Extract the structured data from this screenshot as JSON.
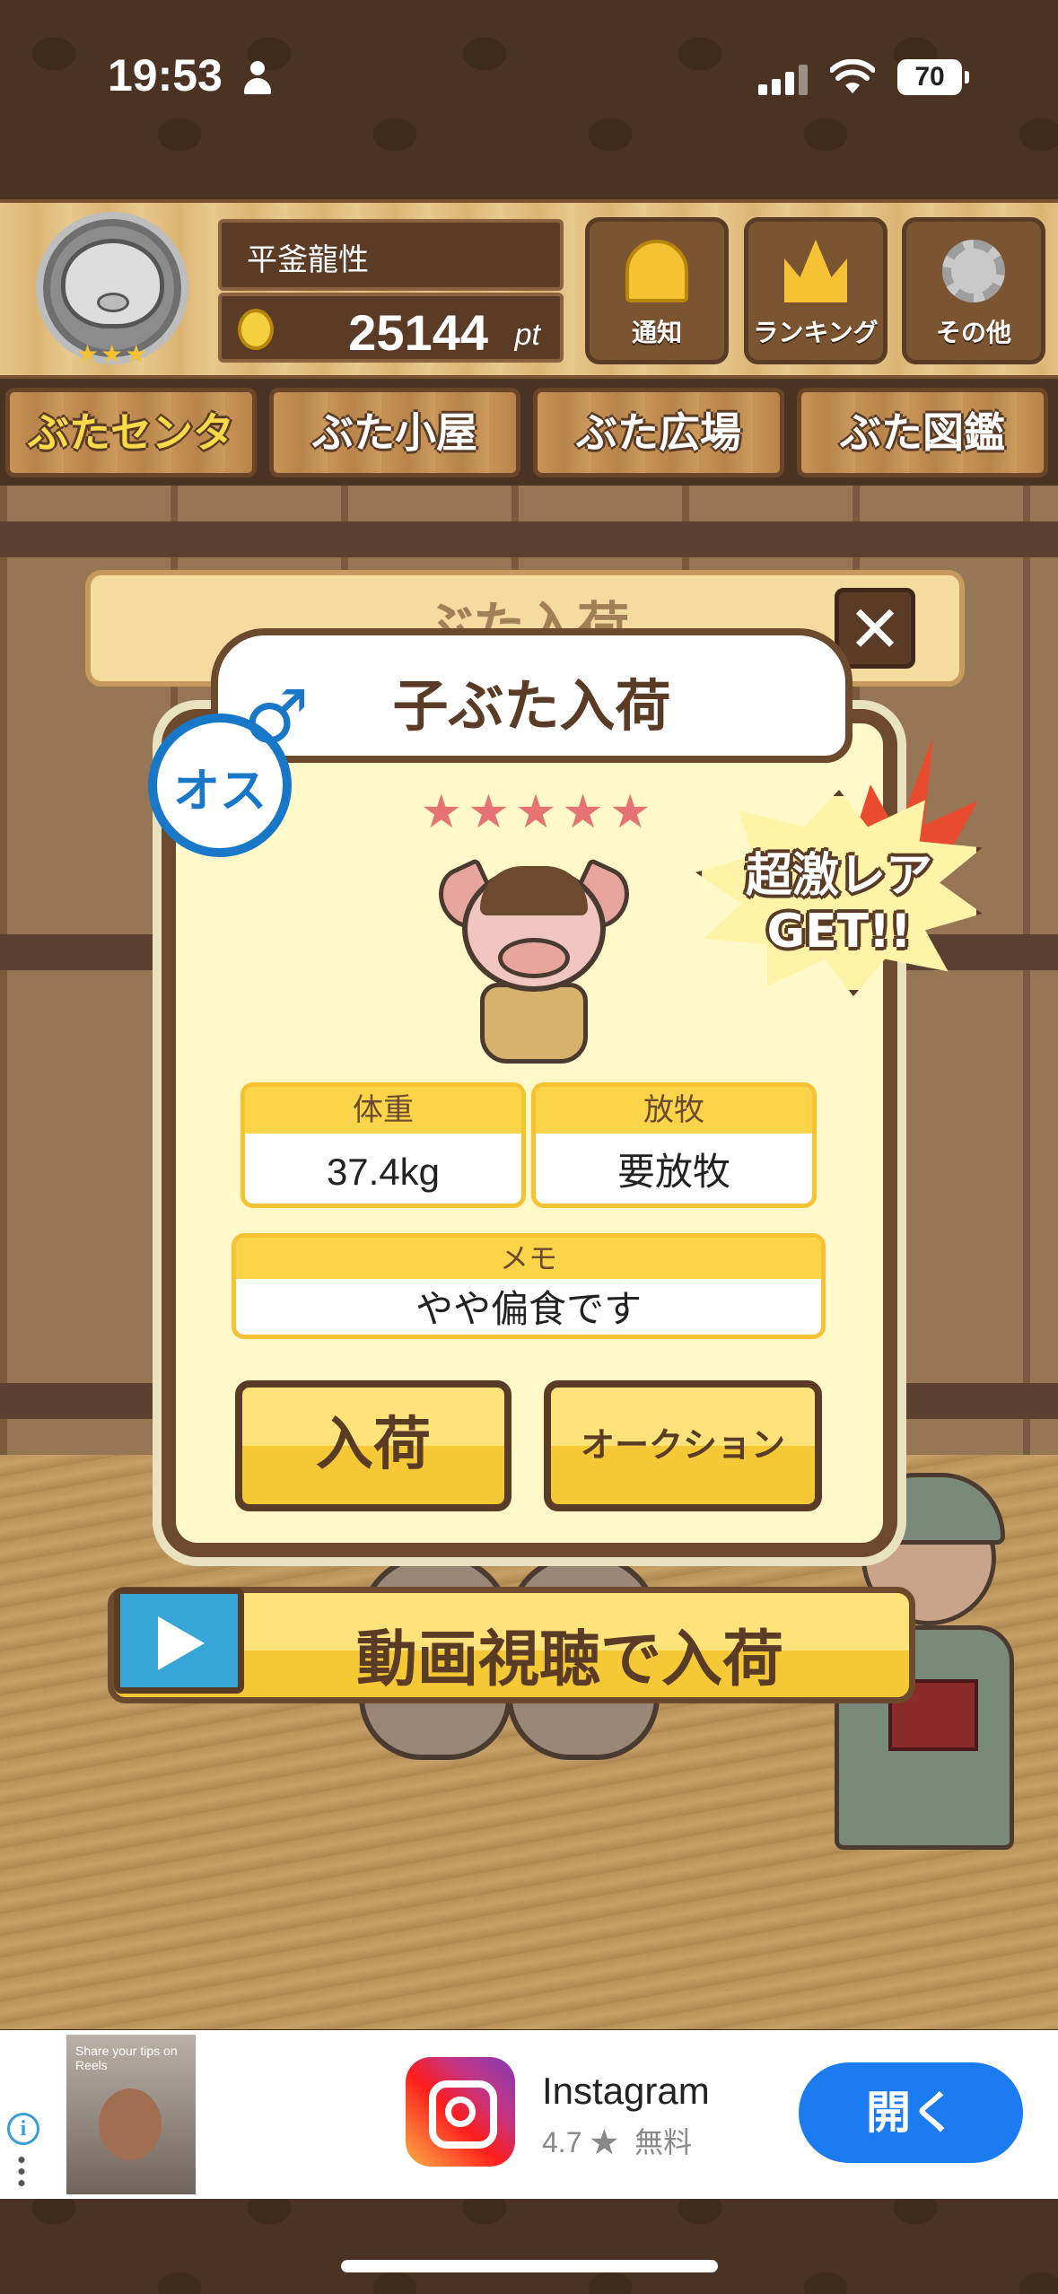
{
  "status_bar": {
    "time": "19:53",
    "battery": "70"
  },
  "header": {
    "player_name": "平釜龍性",
    "points": "25144",
    "points_unit": "pt",
    "avatar_stars": "★★★",
    "buttons": [
      {
        "label": "通知",
        "icon": "bell-icon"
      },
      {
        "label": "ランキング",
        "icon": "crown-icon"
      },
      {
        "label": "その他",
        "icon": "gear-icon"
      }
    ]
  },
  "tabs": [
    {
      "label": "ぶたセンター",
      "active": true
    },
    {
      "label": "ぶた小屋",
      "active": false
    },
    {
      "label": "ぶた広場",
      "active": false
    },
    {
      "label": "ぶた図鑑",
      "active": false
    }
  ],
  "background_sign": {
    "title": "ぶた入荷",
    "close_symbol": "✕"
  },
  "modal": {
    "title": "子ぶた入荷",
    "gender": "オス",
    "gender_symbol": "♂",
    "rarity_stars": "★★★★★",
    "rarity_label": "超激レア GET!!",
    "weight_label": "体重",
    "weight_value": "37.4kg",
    "grazing_label": "放牧",
    "grazing_value": "要放牧",
    "memo_label": "メモ",
    "memo_value": "やや偏食です",
    "accept_label": "入荷",
    "auction_label": "オークション"
  },
  "video_button": {
    "label": "動画視聴で入荷"
  },
  "ad": {
    "thumb_text": "Share your tips on Reels",
    "app_name": "Instagram",
    "rating": "4.7 ★",
    "price": "無料",
    "open_label": "開く"
  },
  "colors": {
    "wood_dark": "#5a3b26",
    "button_yellow": "#f5c935",
    "male_blue": "#1977c7",
    "open_button_blue": "#1a7cf0"
  }
}
